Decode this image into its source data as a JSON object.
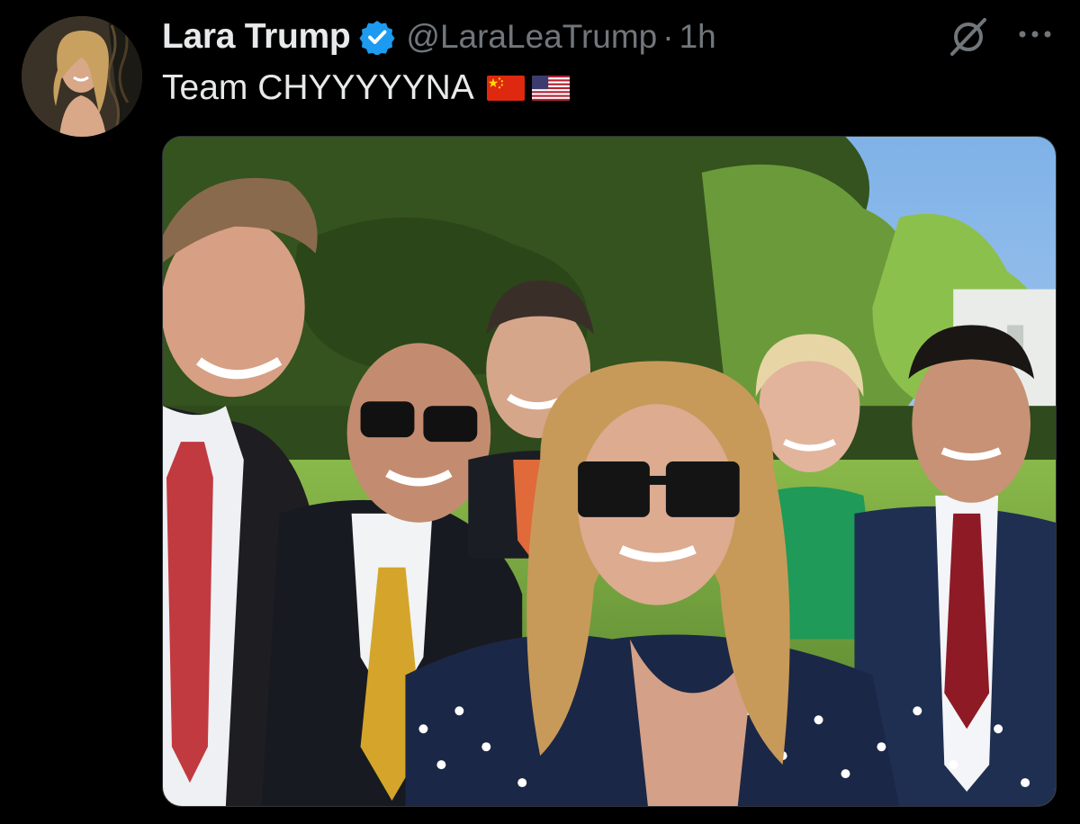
{
  "tweet": {
    "author": {
      "display_name": "Lara Trump",
      "handle": "@LaraLeaTrump",
      "verified": true,
      "avatar_icon": "profile-photo"
    },
    "separator": "·",
    "time": "1h",
    "text": "Team CHYYYYYNA",
    "emoji": [
      "china-flag",
      "us-flag"
    ],
    "media": {
      "type": "photo"
    },
    "actions": {
      "grok_icon": "grok-icon",
      "more_icon": "more-icon"
    }
  },
  "colors": {
    "background": "#000000",
    "primary_text": "#e7e9ea",
    "secondary_text": "#71767b",
    "verified_blue": "#1d9bf0"
  }
}
